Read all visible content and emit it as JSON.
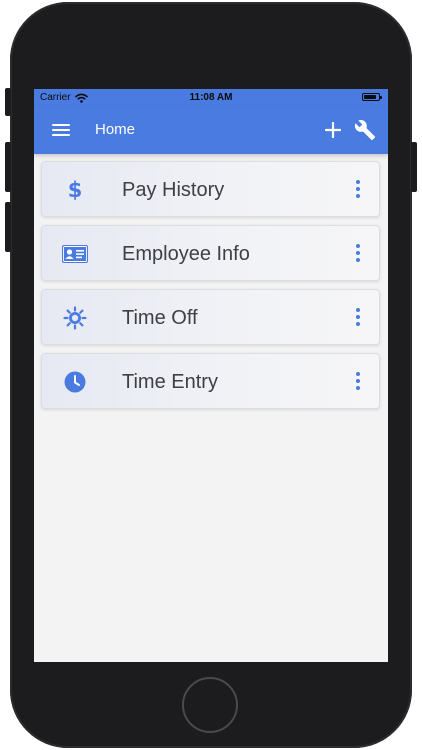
{
  "status_bar": {
    "carrier": "Carrier",
    "time": "11:08 AM",
    "wifi_icon": "wifi-icon",
    "battery_icon": "battery-icon"
  },
  "app_bar": {
    "title": "Home",
    "menu_icon": "hamburger-menu-icon",
    "add_icon": "plus-icon",
    "settings_icon": "wrench-icon"
  },
  "menu_items": [
    {
      "label": "Pay History",
      "icon": "dollar-icon"
    },
    {
      "label": "Employee Info",
      "icon": "id-card-icon"
    },
    {
      "label": "Time Off",
      "icon": "sun-icon"
    },
    {
      "label": "Time Entry",
      "icon": "clock-icon"
    }
  ],
  "more_icon": "vertical-dots-icon",
  "colors": {
    "accent": "#4a7be0",
    "screen_background": "#f3f3f4",
    "card_text": "#3f3f44",
    "device_frame": "#1c1c1e"
  }
}
